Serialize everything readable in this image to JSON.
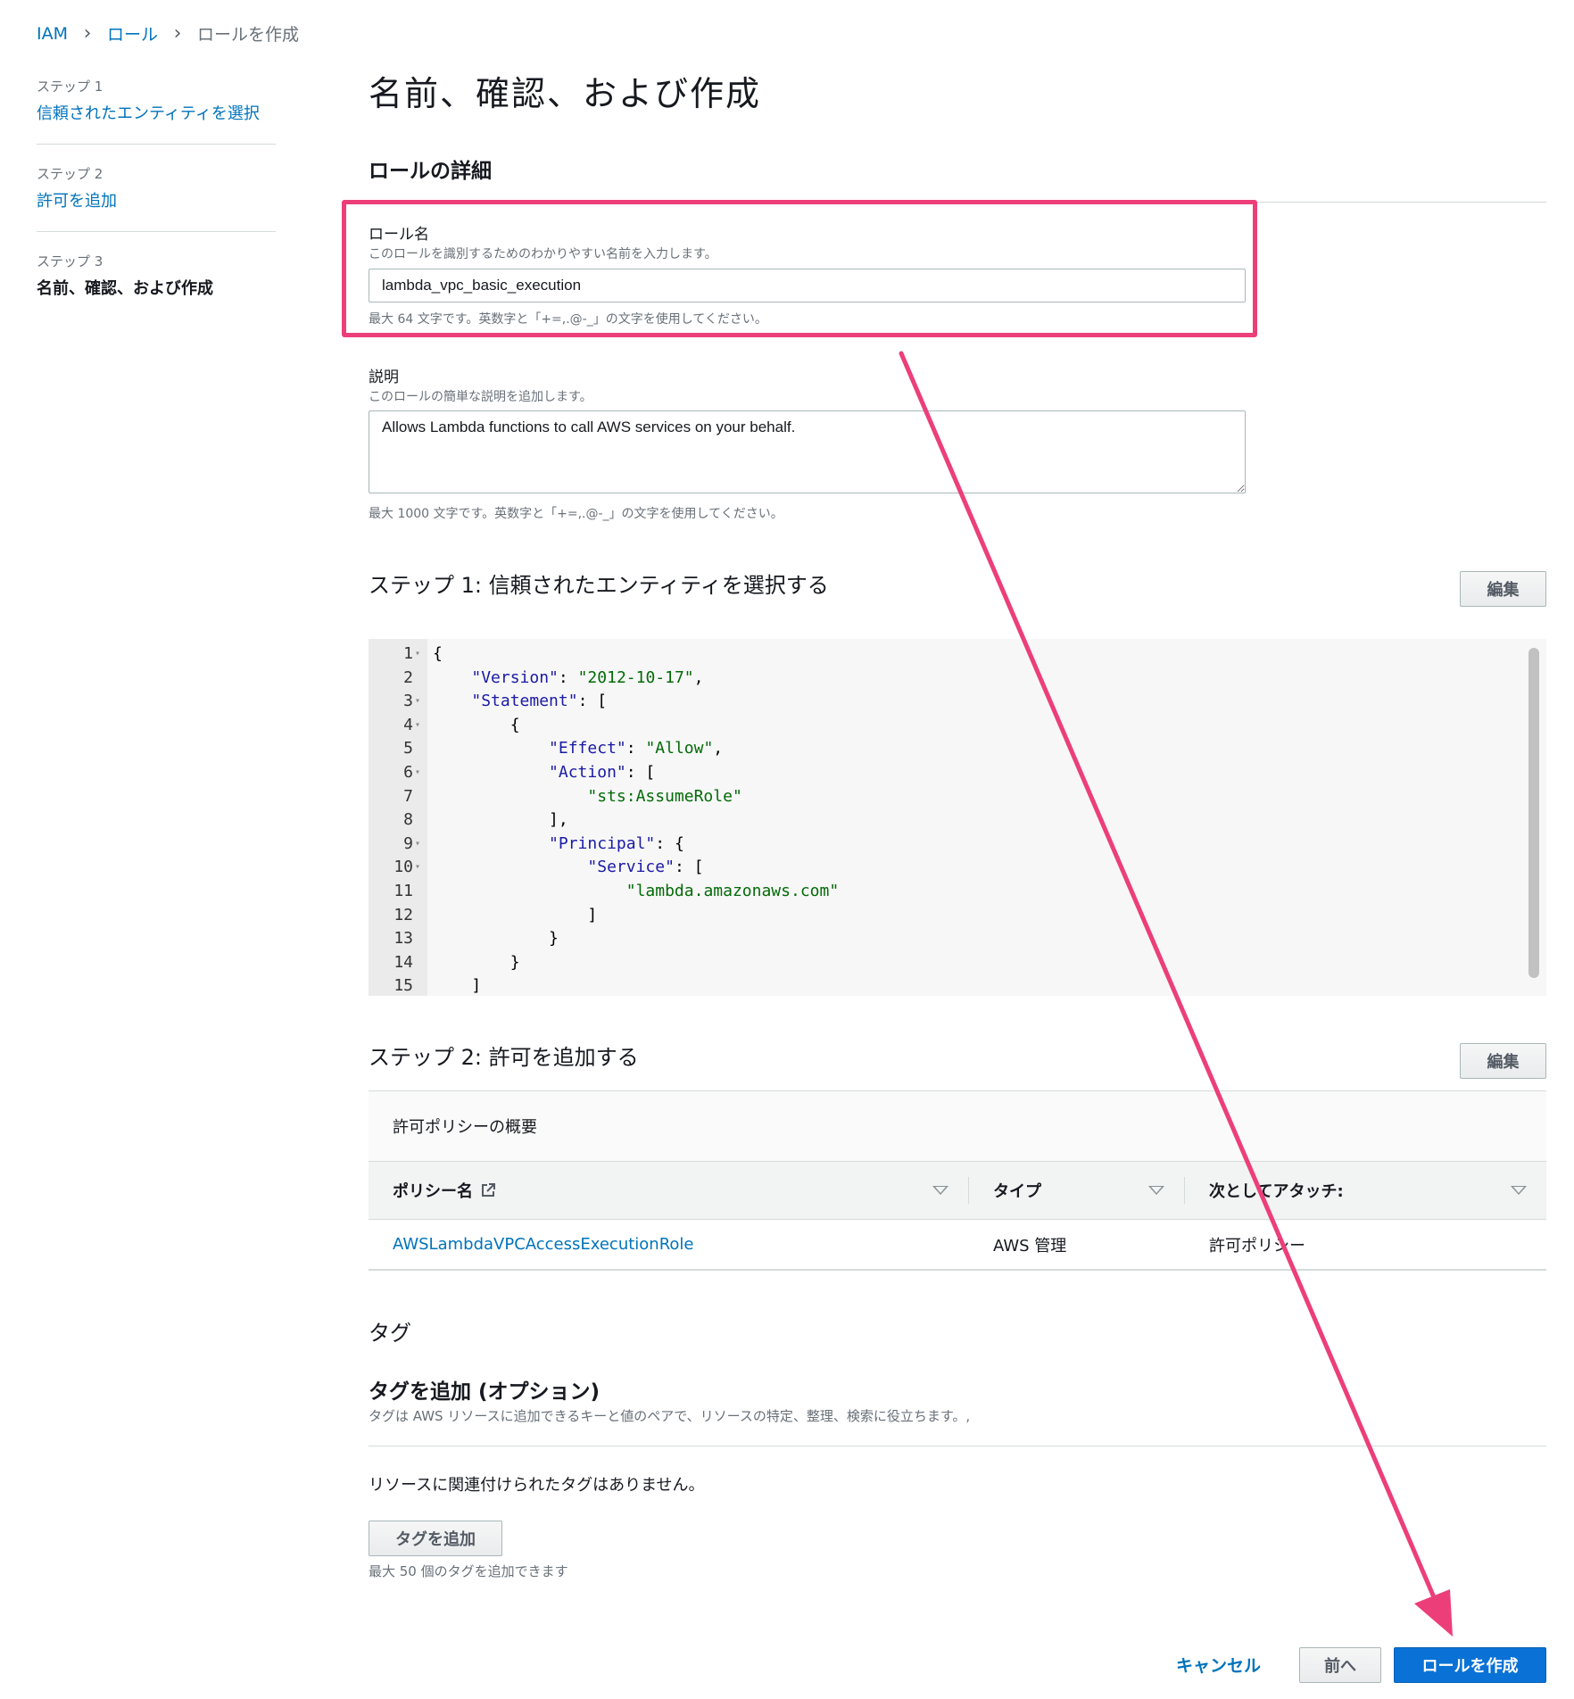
{
  "breadcrumb": {
    "items": [
      "IAM",
      "ロール"
    ],
    "current": "ロールを作成"
  },
  "nav": {
    "steps": [
      {
        "num": "ステップ 1",
        "label": "信頼されたエンティティを選択"
      },
      {
        "num": "ステップ 2",
        "label": "許可を追加"
      },
      {
        "num": "ステップ 3",
        "label": "名前、確認、および作成"
      }
    ]
  },
  "page_title": "名前、確認、および作成",
  "role_details": {
    "title": "ロールの詳細",
    "name_label": "ロール名",
    "name_desc": "このロールを識別するためのわかりやすい名前を入力します。",
    "name_value": "lambda_vpc_basic_execution",
    "name_hint": "最大 64 文字です。英数字と「+=,.@-_」の文字を使用してください。",
    "desc_label": "説明",
    "desc_desc": "このロールの簡単な説明を追加します。",
    "desc_value": "Allows Lambda functions to call AWS services on your behalf.",
    "desc_hint": "最大 1000 文字です。英数字と「+=,.@-_」の文字を使用してください。"
  },
  "step1": {
    "title": "ステップ 1: 信頼されたエンティティを選択する",
    "edit_label": "編集",
    "code_lines": [
      {
        "n": "1",
        "fold": true,
        "text": "{"
      },
      {
        "n": "2",
        "fold": false,
        "text": "    \"Version\": \"2012-10-17\","
      },
      {
        "n": "3",
        "fold": true,
        "text": "    \"Statement\": ["
      },
      {
        "n": "4",
        "fold": true,
        "text": "        {"
      },
      {
        "n": "5",
        "fold": false,
        "text": "            \"Effect\": \"Allow\","
      },
      {
        "n": "6",
        "fold": true,
        "text": "            \"Action\": ["
      },
      {
        "n": "7",
        "fold": false,
        "text": "                \"sts:AssumeRole\""
      },
      {
        "n": "8",
        "fold": false,
        "text": "            ],"
      },
      {
        "n": "9",
        "fold": true,
        "text": "            \"Principal\": {"
      },
      {
        "n": "10",
        "fold": true,
        "text": "                \"Service\": ["
      },
      {
        "n": "11",
        "fold": false,
        "text": "                    \"lambda.amazonaws.com\""
      },
      {
        "n": "12",
        "fold": false,
        "text": "                ]"
      },
      {
        "n": "13",
        "fold": false,
        "text": "            }"
      },
      {
        "n": "14",
        "fold": false,
        "text": "        }"
      },
      {
        "n": "15",
        "fold": false,
        "text": "    ]"
      }
    ]
  },
  "step2": {
    "title": "ステップ 2: 許可を追加する",
    "edit_label": "編集",
    "table_title": "許可ポリシーの概要",
    "columns": [
      "ポリシー名",
      "タイプ",
      "次としてアタッチ:"
    ],
    "rows": [
      {
        "name": "AWSLambdaVPCAccessExecutionRole",
        "type": "AWS 管理",
        "attach": "許可ポリシー"
      }
    ]
  },
  "tags": {
    "heading": "タグ",
    "title": "タグを追加 (オプション)",
    "desc": "タグは AWS リソースに追加できるキーと値のペアで、リソースの特定、整理、検索に役立ちます。,",
    "empty": "リソースに関連付けられたタグはありません。",
    "add_button": "タグを追加",
    "limit_hint": "最大 50 個のタグを追加できます"
  },
  "footer": {
    "cancel": "キャンセル",
    "previous": "前へ",
    "create": "ロールを作成"
  },
  "colors": {
    "link": "#0073bb",
    "primary": "#0a72d6",
    "annotation": "#ec3f79"
  }
}
